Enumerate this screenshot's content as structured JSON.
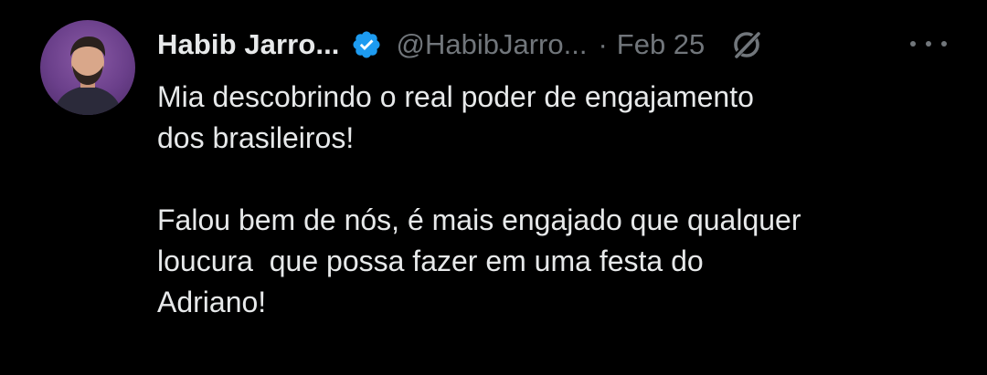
{
  "author": {
    "display_name": "Habib Jarro...",
    "handle": "@HabibJarro...",
    "verified_icon": "verified-badge-icon",
    "avatar_icon": "avatar"
  },
  "meta": {
    "separator": "·",
    "date": "Feb 25",
    "grok_icon": "grok-icon",
    "more_icon": "more-options-icon"
  },
  "content": {
    "paragraph1_line1": "Mia descobrindo o real poder de engajamento",
    "paragraph1_line2": "dos brasileiros!",
    "paragraph2_line1": "Falou bem de nós, é mais engajado que qualquer",
    "paragraph2_line2": "loucura  que possa fazer em uma festa do",
    "paragraph2_line3": "Adriano!"
  },
  "colors": {
    "background": "#000000",
    "primary_text": "#e7e9ea",
    "secondary_text": "#71767b",
    "verified_blue": "#1d9bf0"
  }
}
